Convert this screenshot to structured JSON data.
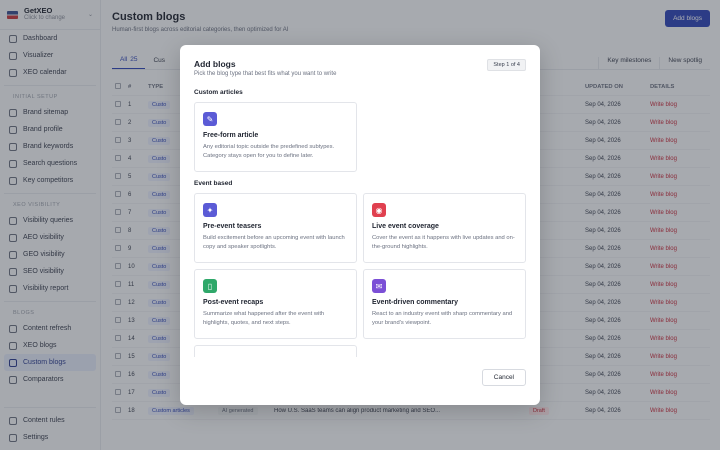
{
  "sidebar": {
    "brand_name": "GetXEO",
    "brand_sub": "Click to change",
    "top_items": [
      "Dashboard",
      "Visualizer",
      "XEO calendar"
    ],
    "sections": [
      {
        "title": "INITIAL SETUP",
        "items": [
          "Brand sitemap",
          "Brand profile",
          "Brand keywords",
          "Search questions",
          "Key competitors"
        ]
      },
      {
        "title": "XEO VISIBILITY",
        "items": [
          "Visibility queries",
          "AEO visibility",
          "GEO visibility",
          "SEO visibility",
          "Visibility report"
        ]
      },
      {
        "title": "BLOGS",
        "items": [
          "Content refresh",
          "XEO blogs",
          "Custom blogs",
          "Comparators"
        ]
      }
    ],
    "bottom_items": [
      "Content rules",
      "Settings"
    ]
  },
  "header": {
    "title": "Custom blogs",
    "subtitle": "Human-first blogs across editorial categories, then optimized for AI",
    "add_button": "Add blogs"
  },
  "tabs": {
    "all_label": "All",
    "all_count": "25",
    "second_label": "Cus",
    "key_milestones": "Key milestones",
    "new_spotlight": "New spotlig"
  },
  "table": {
    "headers": {
      "num": "#",
      "type": "TYPE",
      "updated": "UPDATED ON",
      "details": "DETAILS"
    },
    "rows": [
      {
        "num": "1",
        "type": "Custo",
        "updated": "Sep 04, 2026",
        "details": "Write blog"
      },
      {
        "num": "2",
        "type": "Custo",
        "updated": "Sep 04, 2026",
        "details": "Write blog"
      },
      {
        "num": "3",
        "type": "Custo",
        "updated": "Sep 04, 2026",
        "details": "Write blog"
      },
      {
        "num": "4",
        "type": "Custo",
        "updated": "Sep 04, 2026",
        "details": "Write blog"
      },
      {
        "num": "5",
        "type": "Custo",
        "updated": "Sep 04, 2026",
        "details": "Write blog"
      },
      {
        "num": "6",
        "type": "Custo",
        "updated": "Sep 04, 2026",
        "details": "Write blog"
      },
      {
        "num": "7",
        "type": "Custo",
        "updated": "Sep 04, 2026",
        "details": "Write blog"
      },
      {
        "num": "8",
        "type": "Custo",
        "updated": "Sep 04, 2026",
        "details": "Write blog"
      },
      {
        "num": "9",
        "type": "Custo",
        "updated": "Sep 04, 2026",
        "details": "Write blog"
      },
      {
        "num": "10",
        "type": "Custo",
        "updated": "Sep 04, 2026",
        "details": "Write blog"
      },
      {
        "num": "11",
        "type": "Custo",
        "updated": "Sep 04, 2026",
        "details": "Write blog"
      },
      {
        "num": "12",
        "type": "Custo",
        "updated": "Sep 04, 2026",
        "details": "Write blog"
      },
      {
        "num": "13",
        "type": "Custo",
        "updated": "Sep 04, 2026",
        "details": "Write blog"
      },
      {
        "num": "14",
        "type": "Custo",
        "updated": "Sep 04, 2026",
        "details": "Write blog"
      },
      {
        "num": "15",
        "type": "Custo",
        "updated": "Sep 04, 2026",
        "details": "Write blog"
      },
      {
        "num": "16",
        "type": "Custo",
        "updated": "Sep 04, 2026",
        "details": "Write blog"
      },
      {
        "num": "17",
        "type": "Custo",
        "updated": "Sep 04, 2026",
        "details": "Write blog"
      }
    ],
    "last_row": {
      "num": "18",
      "type": "Custom articles",
      "gen": "AI generated",
      "title": "How U.S. SaaS teams can align product marketing and SEO...",
      "status": "Draft",
      "updated": "Sep 04, 2026",
      "details": "Write blog"
    }
  },
  "modal": {
    "title": "Add blogs",
    "subtitle": "Pick the blog type that best fits what you want to write",
    "step": "Step 1 of 4",
    "sections": [
      {
        "title": "Custom articles",
        "cards": [
          {
            "icon": "pencil-icon",
            "color": "#5b5bd6",
            "title": "Free-form article",
            "desc": "Any editorial topic outside the predefined subtypes. Category stays open for you to define later."
          }
        ]
      },
      {
        "title": "Event based",
        "cards": [
          {
            "icon": "sparkle-icon",
            "color": "#5b5bd6",
            "title": "Pre-event teasers",
            "desc": "Build excitement before an upcoming event with launch copy and speaker spotlights."
          },
          {
            "icon": "broadcast-icon",
            "color": "#e0404f",
            "title": "Live event coverage",
            "desc": "Cover the event as it happens with live updates and on-the-ground highlights."
          },
          {
            "icon": "document-icon",
            "color": "#2fa86a",
            "title": "Post-event recaps",
            "desc": "Summarize what happened after the event with highlights, quotes, and next steps."
          },
          {
            "icon": "chat-icon",
            "color": "#7b4fd6",
            "title": "Event-driven commentary",
            "desc": "React to an industry event with sharp commentary and your brand's viewpoint."
          }
        ]
      }
    ],
    "cancel": "Cancel"
  }
}
